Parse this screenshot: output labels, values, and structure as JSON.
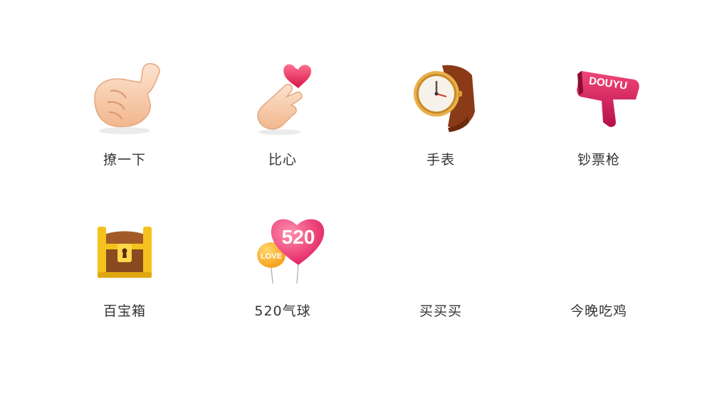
{
  "gifts": [
    {
      "label": "撩一下",
      "icon": "beckoning-hand-icon"
    },
    {
      "label": "比心",
      "icon": "finger-heart-icon"
    },
    {
      "label": "手表",
      "icon": "wristwatch-icon"
    },
    {
      "label": "钞票枪",
      "icon": "money-gun-icon",
      "brand_text": "DOUYU"
    },
    {
      "label": "百宝箱",
      "icon": "treasure-chest-icon"
    },
    {
      "label": "520气球",
      "icon": "balloon-520-icon",
      "balloon_text": "520",
      "small_balloon_text": "LOVE"
    },
    {
      "label": "买买买",
      "icon": ""
    },
    {
      "label": "今晚吃鸡",
      "icon": ""
    }
  ],
  "colors": {
    "label_text": "#333333",
    "background": "#ffffff"
  }
}
